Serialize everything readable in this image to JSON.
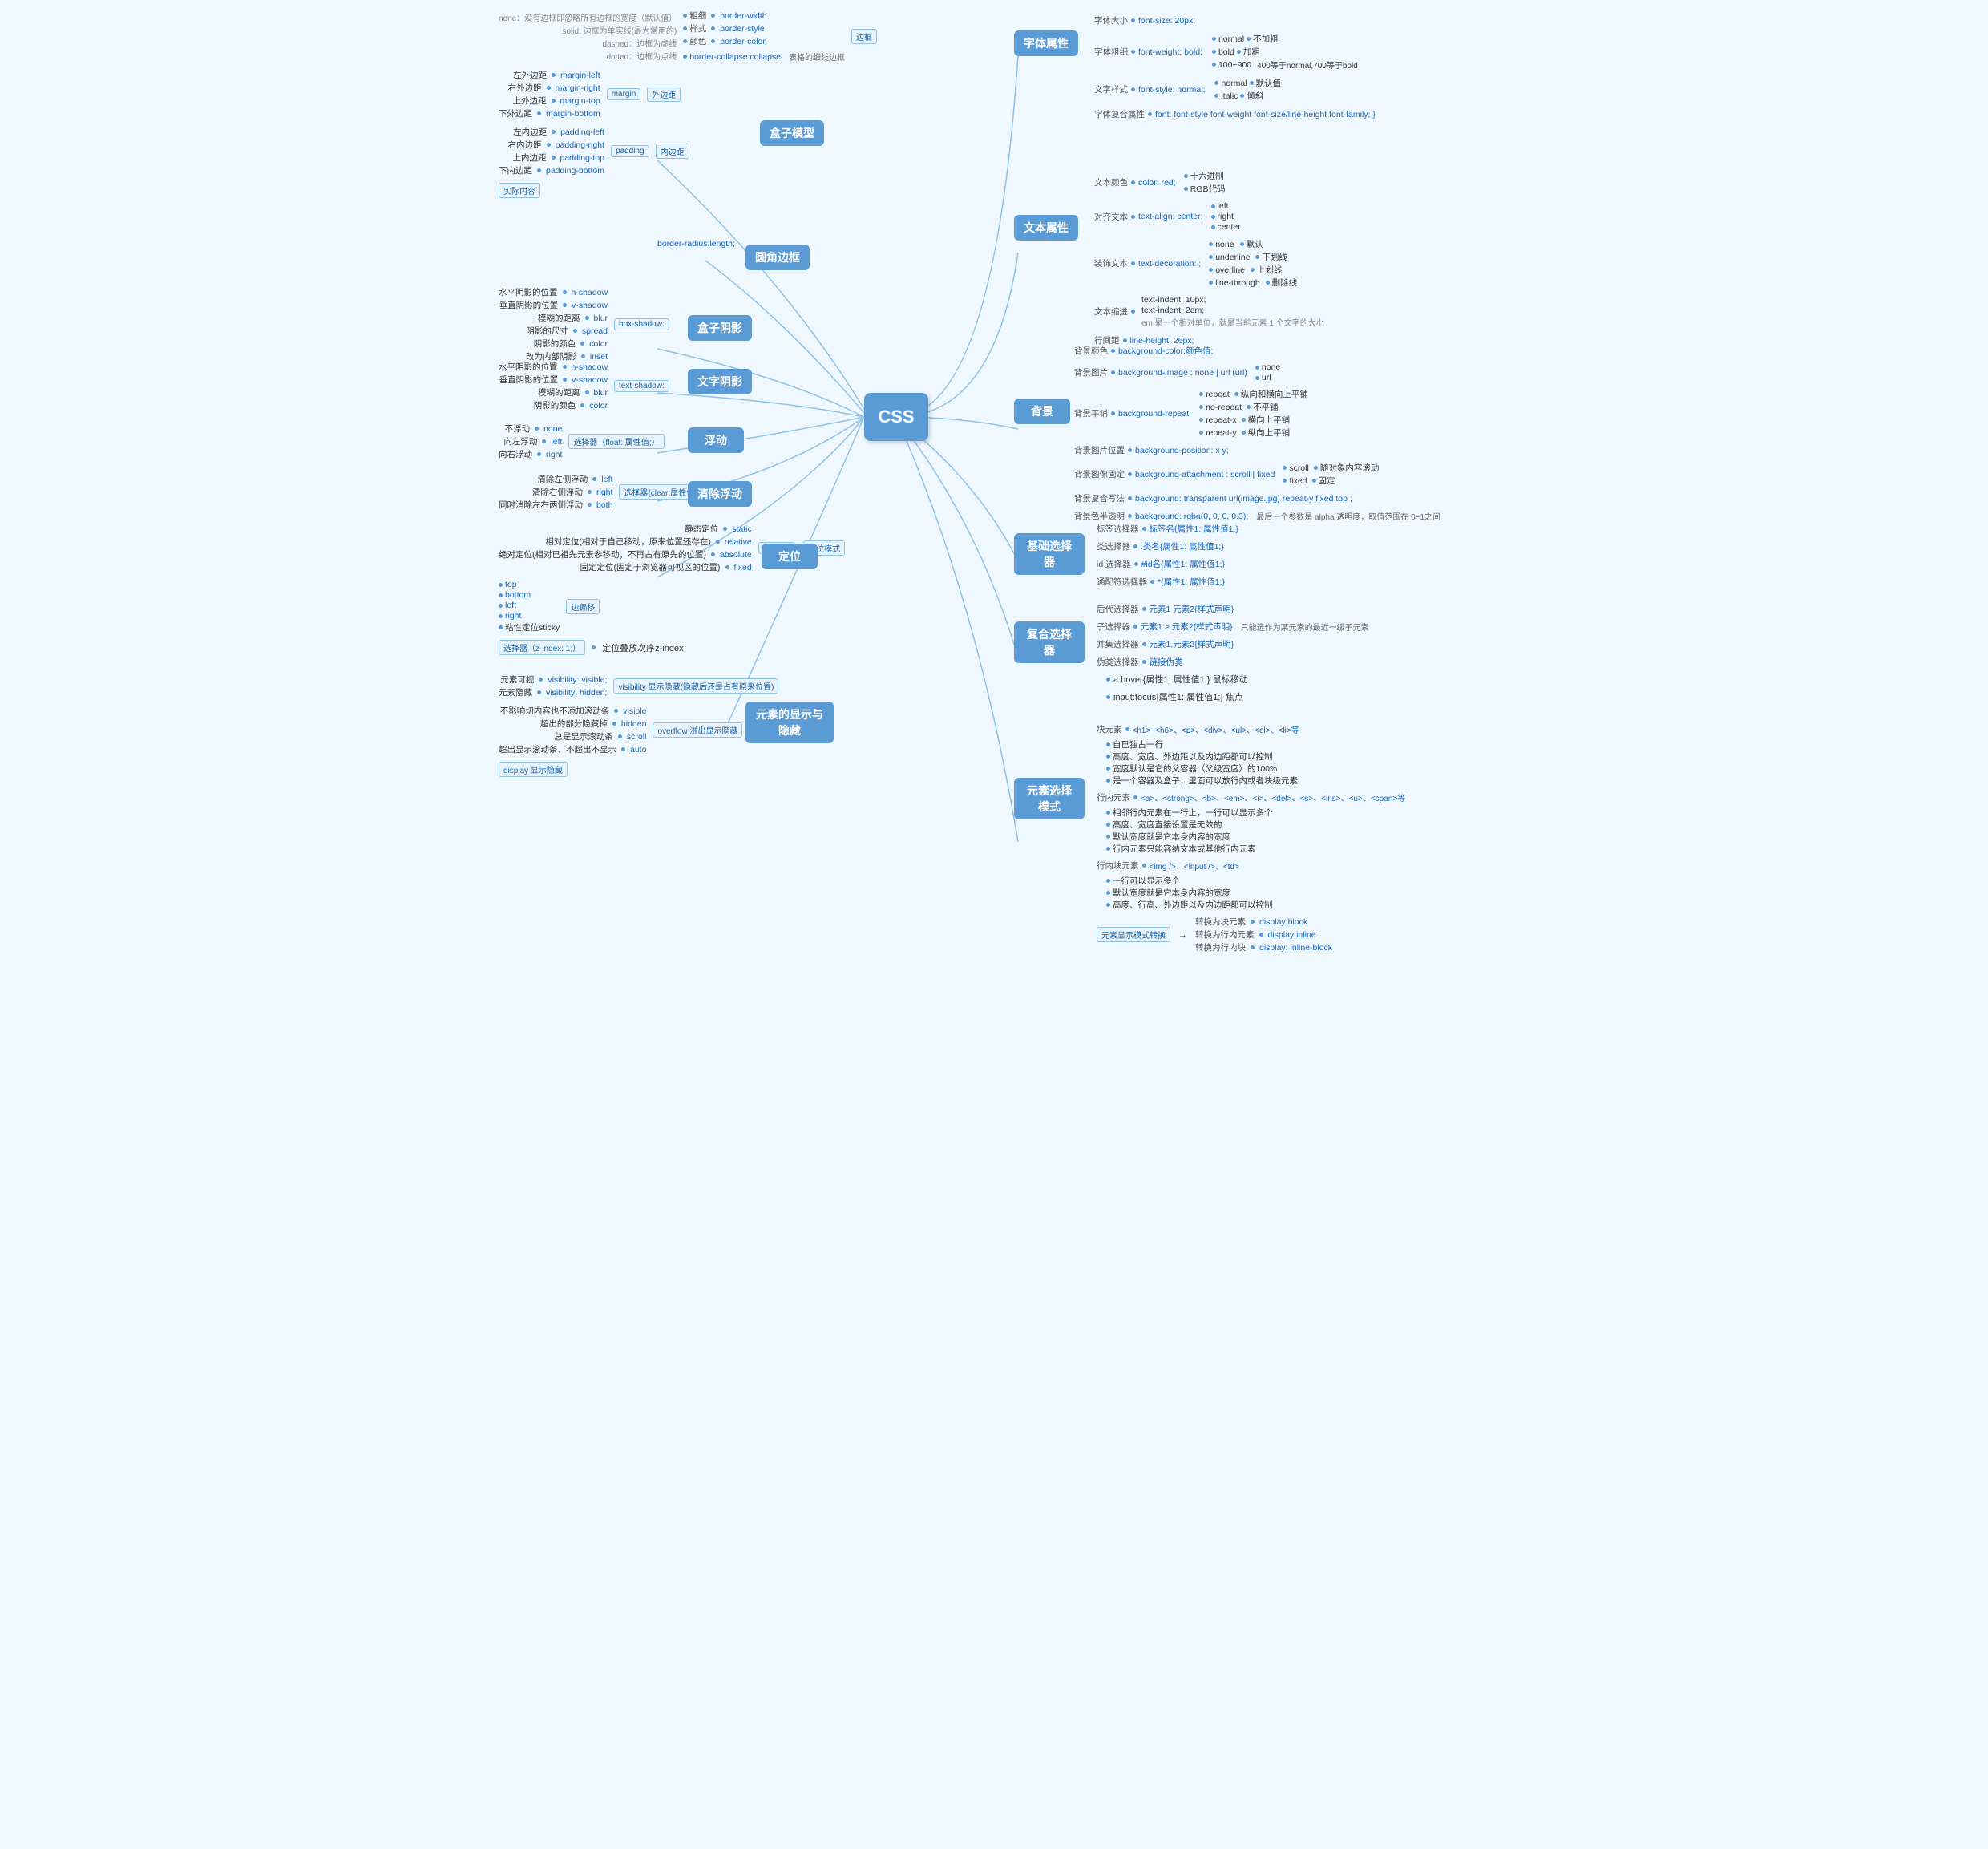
{
  "center": "CSS",
  "branches": {
    "font": "字体属性",
    "text": "文本属性",
    "background": "背景",
    "basic_selector": "基础选择器",
    "complex_selector": "复合选择器",
    "display_mode": "元素选择模式",
    "display_visibility": "元素的显示与隐藏",
    "position": "定位",
    "float": "浮动",
    "clear_float": "清除浮动",
    "box_shadow": "盒子阴影",
    "text_shadow": "文字阴影",
    "box_model": "盒子模型",
    "border_radius": "圆角边框"
  },
  "font_props": {
    "size": "字体大小",
    "size_val": "font-size: 20px;",
    "weight": "字体粗细",
    "weight_val": "font-weight: bold;",
    "weight_options": [
      "normal 不加粗",
      "bold 加粗",
      "100~900  400等于normal,700等于bold"
    ],
    "style": "文字样式",
    "style_val": "font-style: normal;",
    "style_options": [
      "normal 默认值",
      "italic 倾斜"
    ],
    "compound": "字体复合属性",
    "compound_val": "font: font-style font-weight font-size/line-height font-family; }"
  },
  "text_props": {
    "color": "文本颜色",
    "color_val": "color: red;",
    "color_options": [
      "十六进制",
      "RGB代码"
    ],
    "align": "对齐文本",
    "align_val": "text-align: center;",
    "align_options": [
      "left",
      "right",
      "center"
    ],
    "decoration": "装饰文本",
    "decoration_val": "text-decoration: ;",
    "decoration_options": [
      "none 默认",
      "underline 下划线",
      "overline 上划线",
      "line-through 删除线"
    ],
    "indent": "文本缩进",
    "indent_val1": "text-indent: 10px;",
    "indent_val2": "text-indent: 2em;",
    "indent_note": "em 是一个相对单位，就是当前元素 1 个文字的大小",
    "line_height": "行间距",
    "line_height_val": "line-height: 26px;"
  },
  "background_props": {
    "color": "背景颜色",
    "color_val": "background-color:颜色值;",
    "image": "背景图片",
    "image_val": "background-image : none | url (url)",
    "image_options": [
      "none",
      "url"
    ],
    "repeat": "背景平铺",
    "repeat_val": "background-repeat:",
    "repeat_options": [
      "repeat 纵向和横向上平铺",
      "no-repeat 不平铺",
      "repeat-x 横向上平铺",
      "repeat-y 纵向上平铺"
    ],
    "position": "背景图片位置",
    "position_val": "background-position: x y;",
    "attachment": "背景图像固定",
    "attachment_val": "background-attachment : scroll | fixed",
    "attachment_options": [
      "scroll 随对象内容滚动",
      "fixed 固定"
    ],
    "shorthand": "背景复合写法",
    "shorthand_val": "background: transparent url(image.jpg) repeat-y fixed top ;",
    "opacity": "背景色半透明",
    "opacity_val": "background: rgba(0, 0, 0, 0.3);",
    "opacity_note": "最后一个参数是 alpha 透明度，取值范围在 0~1之间"
  },
  "selectors": {
    "tag": "标签选择器",
    "tag_val": "标签名{属性1: 属性值1;}",
    "class": "类选择器",
    "class_val": ".类名{属性1: 属性值1;}",
    "id": "id 选择器",
    "id_val": "#id名{属性1: 属性值1;}",
    "universal": "通配符选择器",
    "universal_val": "*{属性1: 属性值1;}"
  },
  "complex_selectors": {
    "descendant": "后代选择器",
    "descendant_val": "元素1 元素2{样式声明}",
    "child": "子选择器",
    "child_val": "元素1 > 元素2{样式声明}",
    "child_note": "只能选作为某元素的最近一级子元素",
    "adjacent": "并集选择器",
    "adjacent_val": "元素1,元素2{样式声明}",
    "pseudo": "伪类选择器",
    "pseudo_link": "链接伪类",
    "pseudo_hover": "a:hover{属性1: 属性值1;} 鼠标移动",
    "pseudo_focus": "input:focus{属性1: 属性值1;} 焦点"
  },
  "box_model_props": {
    "border": "边框",
    "border_width": "粗细",
    "border_width_val": "border-width",
    "border_style": "样式",
    "border_style_val": "border-style",
    "border_style_options": [
      "none：没有边框即忽略所有边框的宽度（默认值）",
      "solid: 边框为单实线(最为常用的)",
      "dashed：边框为虚线",
      "dotted：边框为点线"
    ],
    "border_color": "颜色",
    "border_color_val": "border-color",
    "border_collapse": "border-collapse:collapse;",
    "border_collapse_desc": "表格的细线边框",
    "margin": "外边距",
    "margin_val": "margin",
    "margin_options": [
      "左外边距 margin-left",
      "右外边距 margin-right",
      "上外边距 margin-top",
      "下外边距 margin-bottom"
    ],
    "padding": "内边距",
    "padding_val": "padding",
    "padding_options": [
      "左内边距 padding-left",
      "右内边距 padding-right",
      "上内边距 padding-top",
      "下内边距 padding-bottom"
    ],
    "content": "实际内容"
  },
  "border_radius": {
    "val": "border-radius:length;"
  },
  "box_shadow_props": {
    "h_shadow": "水平阴影的位置",
    "h_shadow_val": "h-shadow",
    "v_shadow": "垂直阴影的位置",
    "v_shadow_val": "v-shadow",
    "blur": "模糊的距离",
    "blur_val": "blur",
    "spread": "阴影的尺寸",
    "spread_val": "spread",
    "color": "阴影的颜色",
    "color_val": "color",
    "inset": "改为内部阴影",
    "inset_val": "inset",
    "property": "box-shadow:"
  },
  "text_shadow_props": {
    "h_shadow": "水平阴影的位置",
    "h_shadow_val": "h-shadow",
    "v_shadow": "垂直阴影的位置",
    "v_shadow_val": "v-shadow",
    "blur": "模糊的距离",
    "blur_val": "blur",
    "color": "阴影的颜色",
    "color_val": "color",
    "property": "text-shadow:"
  },
  "float_props": {
    "none": "不浮动",
    "none_val": "none",
    "left": "向左浮动",
    "left_val": "left",
    "right": "向右浮动",
    "right_val": "right",
    "selector": "选择器（float: 属性值;）"
  },
  "clear_float_props": {
    "left": "清除左侧浮动",
    "left_val": "left",
    "right": "清除右侧浮动",
    "right_val": "right",
    "both": "同时消除左右两侧浮动",
    "both_val": "both",
    "selector": "选择器{clear:属性值;}"
  },
  "position_props": {
    "static": "静态定位",
    "static_val": "static",
    "relative": "相对定位(相对于自己移动，原来位置还存在)",
    "relative_val": "relative",
    "absolute": "绝对定位(相对已祖先元素参移动，不再占有原先的位置)",
    "absolute_val": "absolute",
    "fixed": "固定定位(固定于浏览器可视区的位置)",
    "fixed_val": "fixed",
    "property": "position",
    "label": "定位模式",
    "offsets": "边偏移",
    "top": "top",
    "bottom": "bottom",
    "left": "left",
    "right": "right",
    "sticky": "粘性定位sticky",
    "z_index": "选择器（z-index: 1;）",
    "z_index_desc": "定位叠放次序z-index"
  },
  "display_visibility_props": {
    "visible": "元素可视",
    "visible_val": "visibility: visible;",
    "hidden": "元素隐藏",
    "hidden_val": "visibility: hidden;",
    "visible2_val": "visible",
    "hidden2_val": "hidden",
    "overflow_desc": "不影响切内容也不添加滚动条",
    "hidden3_val": "超出的部分隐藏掉",
    "scroll_val": "总是显示滚动条",
    "overflow_label": "overflow 溢出显示隐藏",
    "scroll2_val": "scroll",
    "auto_val": "超出显示滚动条、不超出不显示",
    "auto2_val": "auto",
    "visibility_note": "visibility 显示隐藏(隐藏后还是占有原来位置)"
  },
  "display_mode_props": {
    "block_elements": "块元素",
    "block_tags": "<h1>~<h6>、<p>、<div>、<ul>、<ol>、<li>等",
    "block_features": [
      "自已独占一行",
      "高度、宽度、外边距以及内边距都可以控制",
      "宽度默认是它的父容器（父级宽度）的100%",
      "是一个容器及盒子，里面可以放行内或者块级元素"
    ],
    "inline_elements": "行内元素",
    "inline_tags": "<a>、<strong>、<b>、<em>、<i>、<del>、<s>、<ins>、<u>、<span>等",
    "inline_features": [
      "相邻行内元素在一行上，一行可以显示多个",
      "高度、宽度直接设置是无效的",
      "默认宽度就是它本身内容的宽度",
      "行内元素只能容纳文本或其他行内元素"
    ],
    "inline_block_elements": "行内块元素",
    "inline_block_tags": "<img />、<input />、<td>",
    "inline_block_features": [
      "一行可以显示多个",
      "默认宽度就是它本身内容的宽度",
      "高度、行高、外边距以及内边距都可以控制"
    ],
    "to_block": "转换为块元素",
    "to_block_val": "display:block",
    "to_inline": "转换为行内元素",
    "to_inline_val": "display:inline",
    "to_inline_block": "转换为行内块",
    "to_inline_block_val": "display: inline-block",
    "label": "元素显示模式转换"
  }
}
